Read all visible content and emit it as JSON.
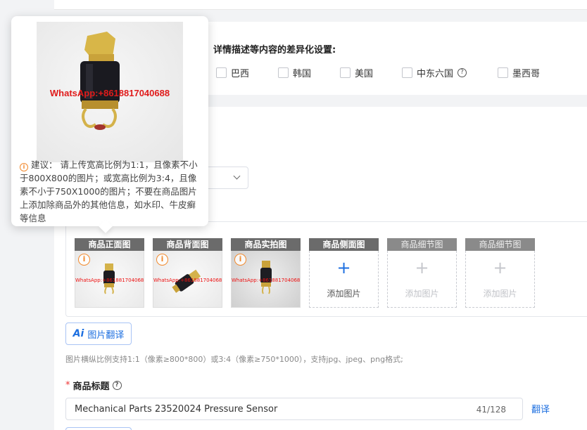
{
  "regions": {
    "title": "详情描述等内容的差异化设置:",
    "options": [
      {
        "label": "巴西",
        "help": false
      },
      {
        "label": "韩国",
        "help": false
      },
      {
        "label": "美国",
        "help": false
      },
      {
        "label": "中东六国",
        "help": true
      },
      {
        "label": "墨西哥",
        "help": false
      }
    ]
  },
  "tooltip": {
    "watermark": "WhatsApp:+8618817040688",
    "suggestion": "建议：  请上传宽高比例为1:1，且像素不小于800X800的图片；或宽高比例为3:4，且像素不小于750X1000的图片；不要在商品图片上添加除商品外的其他信息，如水印、牛皮癣等信息"
  },
  "images": {
    "slots": [
      {
        "label": "商品正面图",
        "state": "filled",
        "watermark": "WhatsApp:+8618817040688",
        "warning": true
      },
      {
        "label": "商品背面图",
        "state": "filled",
        "watermark": "WhatsApp:+8618817040688",
        "warning": true
      },
      {
        "label": "商品实拍图",
        "state": "filled",
        "watermark": "WhatsApp:+8618817040688",
        "warning": true
      },
      {
        "label": "商品侧面图",
        "state": "empty",
        "add_text": "添加图片"
      },
      {
        "label": "商品细节图",
        "state": "disabled",
        "add_text": "添加图片"
      },
      {
        "label": "商品细节图",
        "state": "disabled",
        "add_text": "添加图片"
      }
    ],
    "translate_button": "图片翻译",
    "translate_ai": "Ai",
    "hint": "图片横纵比例支持1:1（像素≥800*800）或3:4（像素≥750*1000），支持jpg、jpeg、png格式;"
  },
  "product_title": {
    "label": "商品标题",
    "required_mark": "*",
    "value": "Mechanical Parts 23520024 Pressure Sensor",
    "counter": "41/128",
    "translate_link": "翻译"
  },
  "colors": {
    "accent": "#1d6fe0",
    "warning": "#f28a2e",
    "watermark": "#e01b1b",
    "label_bg": "#6b6b6b"
  }
}
